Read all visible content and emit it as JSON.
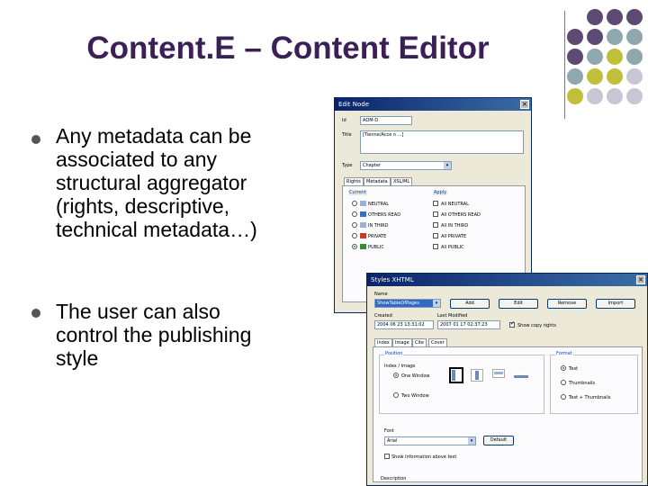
{
  "slide": {
    "title": "Content.E – Content Editor",
    "bullets": [
      {
        "lines": [
          "Any metadata can be",
          "associated to any",
          "structural aggregator",
          "(rights, descriptive,",
          "technical metadata…)"
        ]
      },
      {
        "lines": [
          "The user can also",
          "control the publishing",
          "style"
        ]
      }
    ]
  },
  "decor": {
    "dot_colors": [
      "#5c4a72",
      "#8fa8ad",
      "#bfbf3a",
      "#c7c7d6"
    ]
  },
  "edit_node": {
    "title": "Edit Node",
    "id_value": "ADM-D",
    "label": "Title",
    "title_value": "[Tienne/Acce n ...]",
    "type_label": "Type",
    "type_value": "Chapter",
    "tabs": [
      "Rights",
      "Metadata",
      "XSL/ML"
    ],
    "rights": {
      "current_label": "Current",
      "apply_label": "Apply",
      "current_options": [
        "NEUTRAL",
        "OTHERS READ",
        "IN THIRD",
        "PRIVATE",
        "PUBLIC"
      ],
      "apply_options": [
        "All NEUTRAL",
        "All OTHERS READ",
        "All IN THIRD",
        "All PRIVATE",
        "All PUBLIC"
      ]
    }
  },
  "styles_xhtml": {
    "title": "Styles XHTML",
    "name_label": "Name",
    "name_value": "ShowTableOfPages",
    "buttons": [
      "Add",
      "Edit",
      "Remove",
      "Import"
    ],
    "created_label": "Created",
    "created_value": "2004 06 23  13:31:02",
    "modified_label": "Last Modified",
    "modified_value": "2007 01 17  02:37:23",
    "show_copy_label": "Show copy rights",
    "tabs": [
      "Index",
      "Image",
      "Cite",
      "Cover"
    ],
    "position": {
      "title": "Position",
      "sub": "Index / Image",
      "options": [
        "One Window",
        "Two Window"
      ]
    },
    "format": {
      "title": "Format",
      "options": [
        "Text",
        "Thumbnails",
        "Text + Thumbnails"
      ]
    },
    "font_label": "Font",
    "font_value": "Arial",
    "default_button": "Default",
    "show_info_label": "Show information above text",
    "description_label": "Description"
  }
}
